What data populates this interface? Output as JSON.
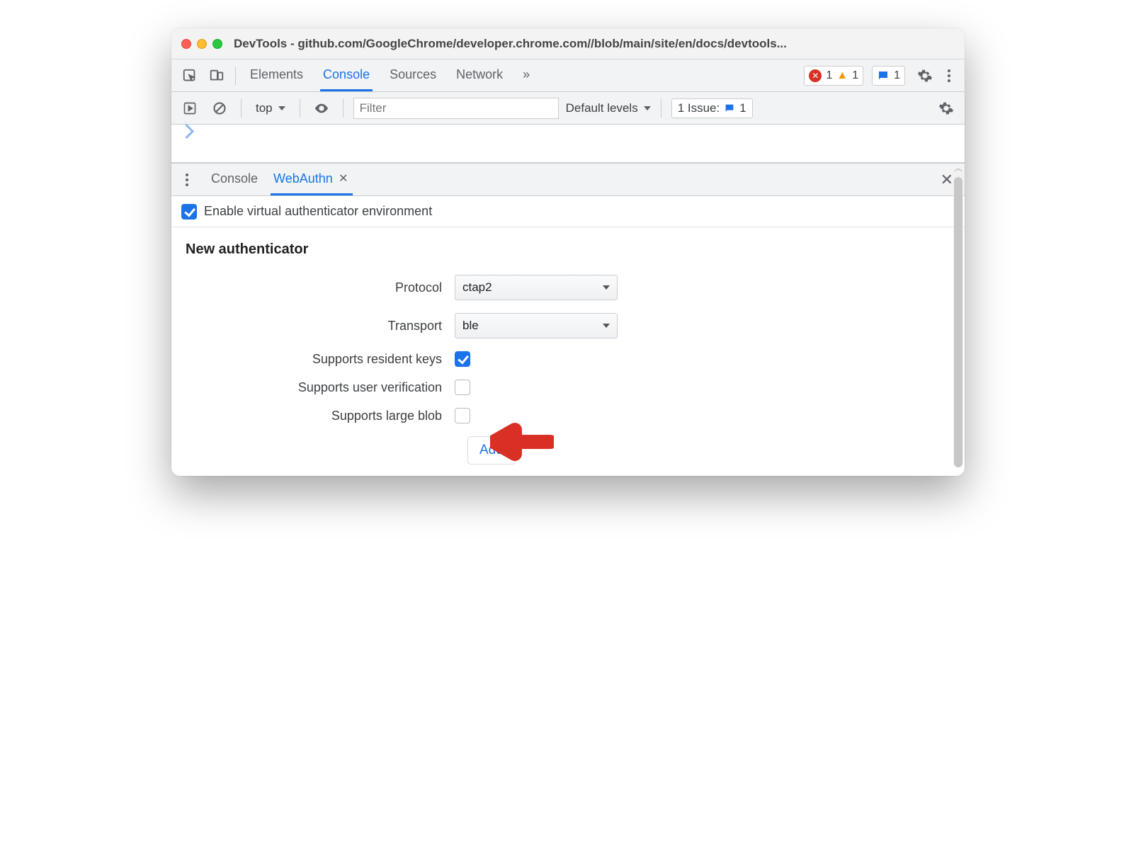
{
  "window": {
    "title": "DevTools - github.com/GoogleChrome/developer.chrome.com//blob/main/site/en/docs/devtools..."
  },
  "tabs": {
    "items": [
      "Elements",
      "Console",
      "Sources",
      "Network"
    ],
    "active": "Console",
    "more_icon": "»"
  },
  "status": {
    "errors": "1",
    "warnings": "1",
    "messages": "1"
  },
  "console_bar": {
    "context": "top",
    "filter_placeholder": "Filter",
    "levels": "Default levels",
    "issues_label": "1 Issue:",
    "issues_count": "1"
  },
  "drawer": {
    "tabs": [
      "Console",
      "WebAuthn"
    ],
    "active": "WebAuthn"
  },
  "webauthn": {
    "enable_label": "Enable virtual authenticator environment",
    "enable_checked": true,
    "section_title": "New authenticator",
    "fields": {
      "protocol": {
        "label": "Protocol",
        "value": "ctap2"
      },
      "transport": {
        "label": "Transport",
        "value": "ble"
      },
      "resident_keys": {
        "label": "Supports resident keys",
        "checked": true
      },
      "user_verification": {
        "label": "Supports user verification",
        "checked": false
      },
      "large_blob": {
        "label": "Supports large blob",
        "checked": false
      }
    },
    "add_button": "Add"
  }
}
